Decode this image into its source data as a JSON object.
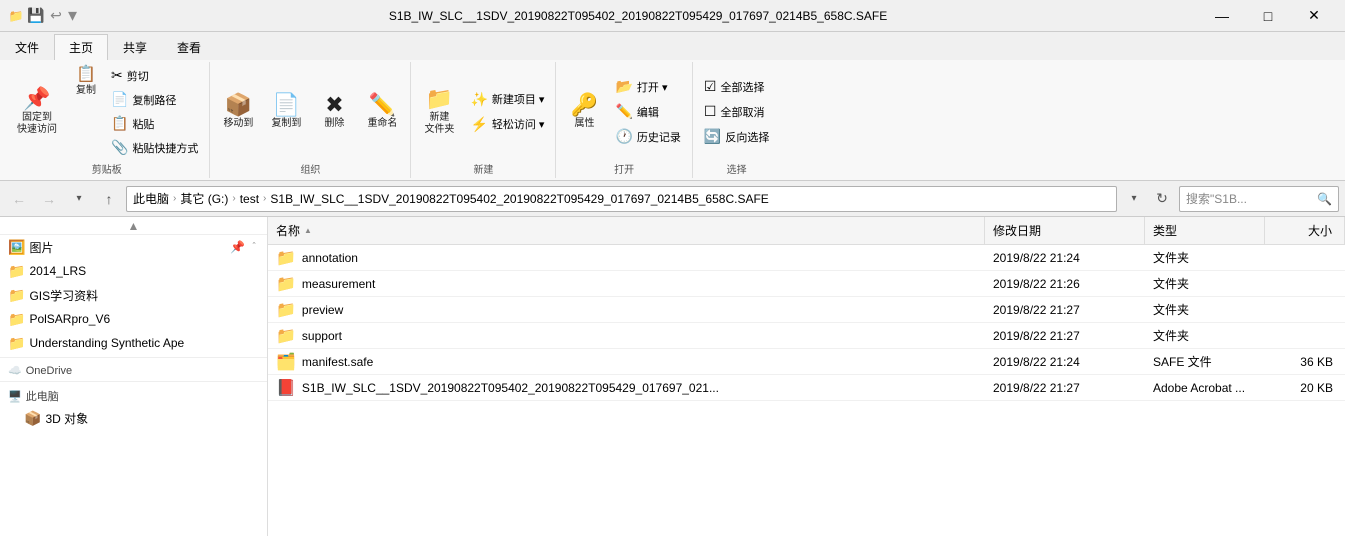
{
  "window": {
    "title": "S1B_IW_SLC__1SDV_20190822T095402_20190822T095429_017697_0214B5_658C.SAFE",
    "icon": "📁"
  },
  "title_bar_btns": {
    "minimize": "—",
    "maximize": "□",
    "close": "✕"
  },
  "ribbon": {
    "tabs": [
      "文件",
      "主页",
      "共享",
      "查看"
    ],
    "active_tab": "主页",
    "groups": [
      {
        "label": "剪贴板",
        "buttons_large": [
          {
            "icon": "📌",
            "label": "固定到\n快速访问"
          }
        ],
        "buttons_small": [
          {
            "icon": "📋",
            "label": "复制"
          },
          {
            "icon": "✂️",
            "label": "剪切"
          },
          {
            "icon": "🔗",
            "label": "复制路径"
          },
          {
            "icon": "📋",
            "label": "粘贴快捷方式"
          },
          {
            "icon": "📋",
            "label": "粘贴"
          }
        ]
      },
      {
        "label": "组织",
        "buttons_large": [
          {
            "icon": "📦",
            "label": "移动到"
          },
          {
            "icon": "📄",
            "label": "复制到"
          },
          {
            "icon": "🗑️",
            "label": "删除"
          },
          {
            "icon": "✏️",
            "label": "重命名"
          }
        ]
      },
      {
        "label": "新建",
        "buttons_large": [
          {
            "icon": "📁",
            "label": "新建\n文件夹"
          }
        ],
        "buttons_small": [
          {
            "icon": "✨",
            "label": "新建项目▾"
          },
          {
            "icon": "⚡",
            "label": "轻松访问▾"
          }
        ]
      },
      {
        "label": "打开",
        "buttons_large": [
          {
            "icon": "🔑",
            "label": "属性"
          }
        ],
        "buttons_small": [
          {
            "icon": "📂",
            "label": "打开▾"
          },
          {
            "icon": "✏️",
            "label": "编辑"
          },
          {
            "icon": "🕐",
            "label": "历史记录"
          }
        ]
      },
      {
        "label": "选择",
        "buttons_small": [
          {
            "icon": "☑️",
            "label": "全部选择"
          },
          {
            "icon": "☒",
            "label": "全部取消"
          },
          {
            "icon": "🔄",
            "label": "反向选择"
          }
        ]
      }
    ]
  },
  "address_bar": {
    "nav_back": "←",
    "nav_forward": "→",
    "nav_up": "↑",
    "breadcrumbs": [
      "此电脑",
      "其它 (G:)",
      "test",
      "S1B_IW_SLC__1SDV_20190822T095402_20190822T095429_017697_0214B5_658C.SAFE"
    ],
    "refresh_icon": "↻",
    "search_placeholder": "搜索\"S1B...",
    "search_icon": "🔍"
  },
  "sidebar": {
    "items": [
      {
        "icon": "🖼️",
        "label": "图片",
        "pinned": true,
        "show_pin": true
      },
      {
        "icon": "📁",
        "label": "2014_LRS",
        "pinned": false
      },
      {
        "icon": "📁",
        "label": "GIS学习资料",
        "pinned": false
      },
      {
        "icon": "📁",
        "label": "PolSARpro_V6",
        "pinned": false
      },
      {
        "icon": "📁",
        "label": "Understanding Synthetic Ape",
        "pinned": false
      },
      {
        "icon": "☁️",
        "label": "OneDrive",
        "section": true
      },
      {
        "icon": "🖥️",
        "label": "此电脑",
        "section": true
      },
      {
        "icon": "📦",
        "label": "3D 对象",
        "child": true
      }
    ]
  },
  "file_list": {
    "columns": [
      "名称",
      "修改日期",
      "类型",
      "大小"
    ],
    "sort_col": "名称",
    "sort_dir": "asc",
    "items": [
      {
        "icon": "📁",
        "name": "annotation",
        "date": "2019/8/22 21:24",
        "type": "文件夹",
        "size": ""
      },
      {
        "icon": "📁",
        "name": "measurement",
        "date": "2019/8/22 21:26",
        "type": "文件夹",
        "size": ""
      },
      {
        "icon": "📁",
        "name": "preview",
        "date": "2019/8/22 21:27",
        "type": "文件夹",
        "size": ""
      },
      {
        "icon": "📁",
        "name": "support",
        "date": "2019/8/22 21:27",
        "type": "文件夹",
        "size": ""
      },
      {
        "icon": "🗂️",
        "name": "manifest.safe",
        "date": "2019/8/22 21:24",
        "type": "SAFE 文件",
        "size": "36 KB"
      },
      {
        "icon": "📕",
        "name": "S1B_IW_SLC__1SDV_20190822T095402_20190822T095429_017697_021...",
        "date": "2019/8/22 21:27",
        "type": "Adobe Acrobat ...",
        "size": "20 KB"
      }
    ]
  },
  "colors": {
    "accent": "#0078d7",
    "folder": "#e6a817",
    "safe_file": "#5b9bd5",
    "pdf_file": "#e53935",
    "active_tab_bg": "#f8f8f8",
    "ribbon_bg": "#f8f8f8"
  }
}
